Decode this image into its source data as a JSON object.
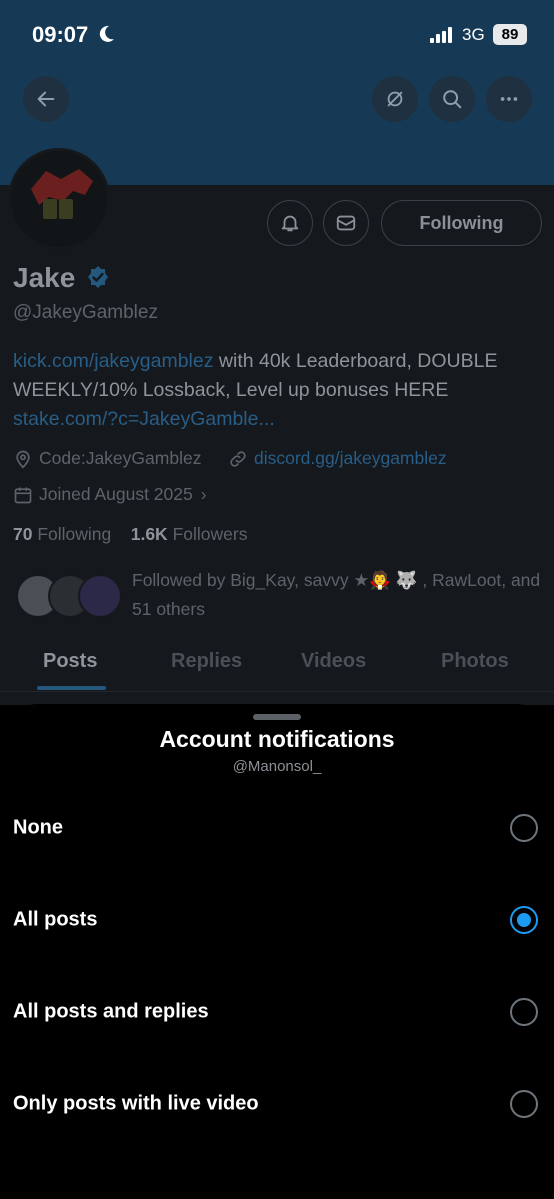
{
  "status_bar": {
    "time": "09:07",
    "network": "3G",
    "battery": "89"
  },
  "profile": {
    "display_name": "Jake",
    "handle": "@JakeyGamblez",
    "bio": {
      "link1": "kick.com/jakeygamblez",
      "text1": " with 40k Leaderboard, DOUBLE WEEKLY/10% Lossback, Level up bonuses HERE ",
      "link2": "stake.com/?c=JakeyGamble..."
    },
    "location": "Code:JakeyGamblez",
    "website": "discord.gg/jakeygamblez",
    "joined": "Joined August 2025",
    "following_count": "70",
    "following_label": "Following",
    "followers_count": "1.6K",
    "followers_label": "Followers",
    "followed_by": "Followed by Big_Kay, savvy ★🧛 🐺 , RawLoot, and 51 others",
    "following_button": "Following"
  },
  "tabs": [
    {
      "label": "Posts",
      "active": true
    },
    {
      "label": "Replies",
      "active": false
    },
    {
      "label": "Videos",
      "active": false
    },
    {
      "label": "Photos",
      "active": false
    }
  ],
  "sheet": {
    "title": "Account notifications",
    "subtitle": "@Manonsol_",
    "options": [
      {
        "label": "None",
        "selected": false
      },
      {
        "label": "All posts",
        "selected": true
      },
      {
        "label": "All posts and replies",
        "selected": false
      },
      {
        "label": "Only posts with live video",
        "selected": false
      }
    ]
  },
  "icons": {
    "back": "arrow-left-icon",
    "mute": "bell-slash-icon",
    "search": "search-icon",
    "more": "more-horizontal-icon",
    "notify": "bell-icon",
    "message": "envelope-icon",
    "verified": "verified-badge-icon",
    "location": "location-pin-icon",
    "link": "link-icon",
    "calendar": "calendar-icon"
  },
  "colors": {
    "accent": "#1d9bf0",
    "banner": "#163a55",
    "sheet_bg": "#000000"
  }
}
